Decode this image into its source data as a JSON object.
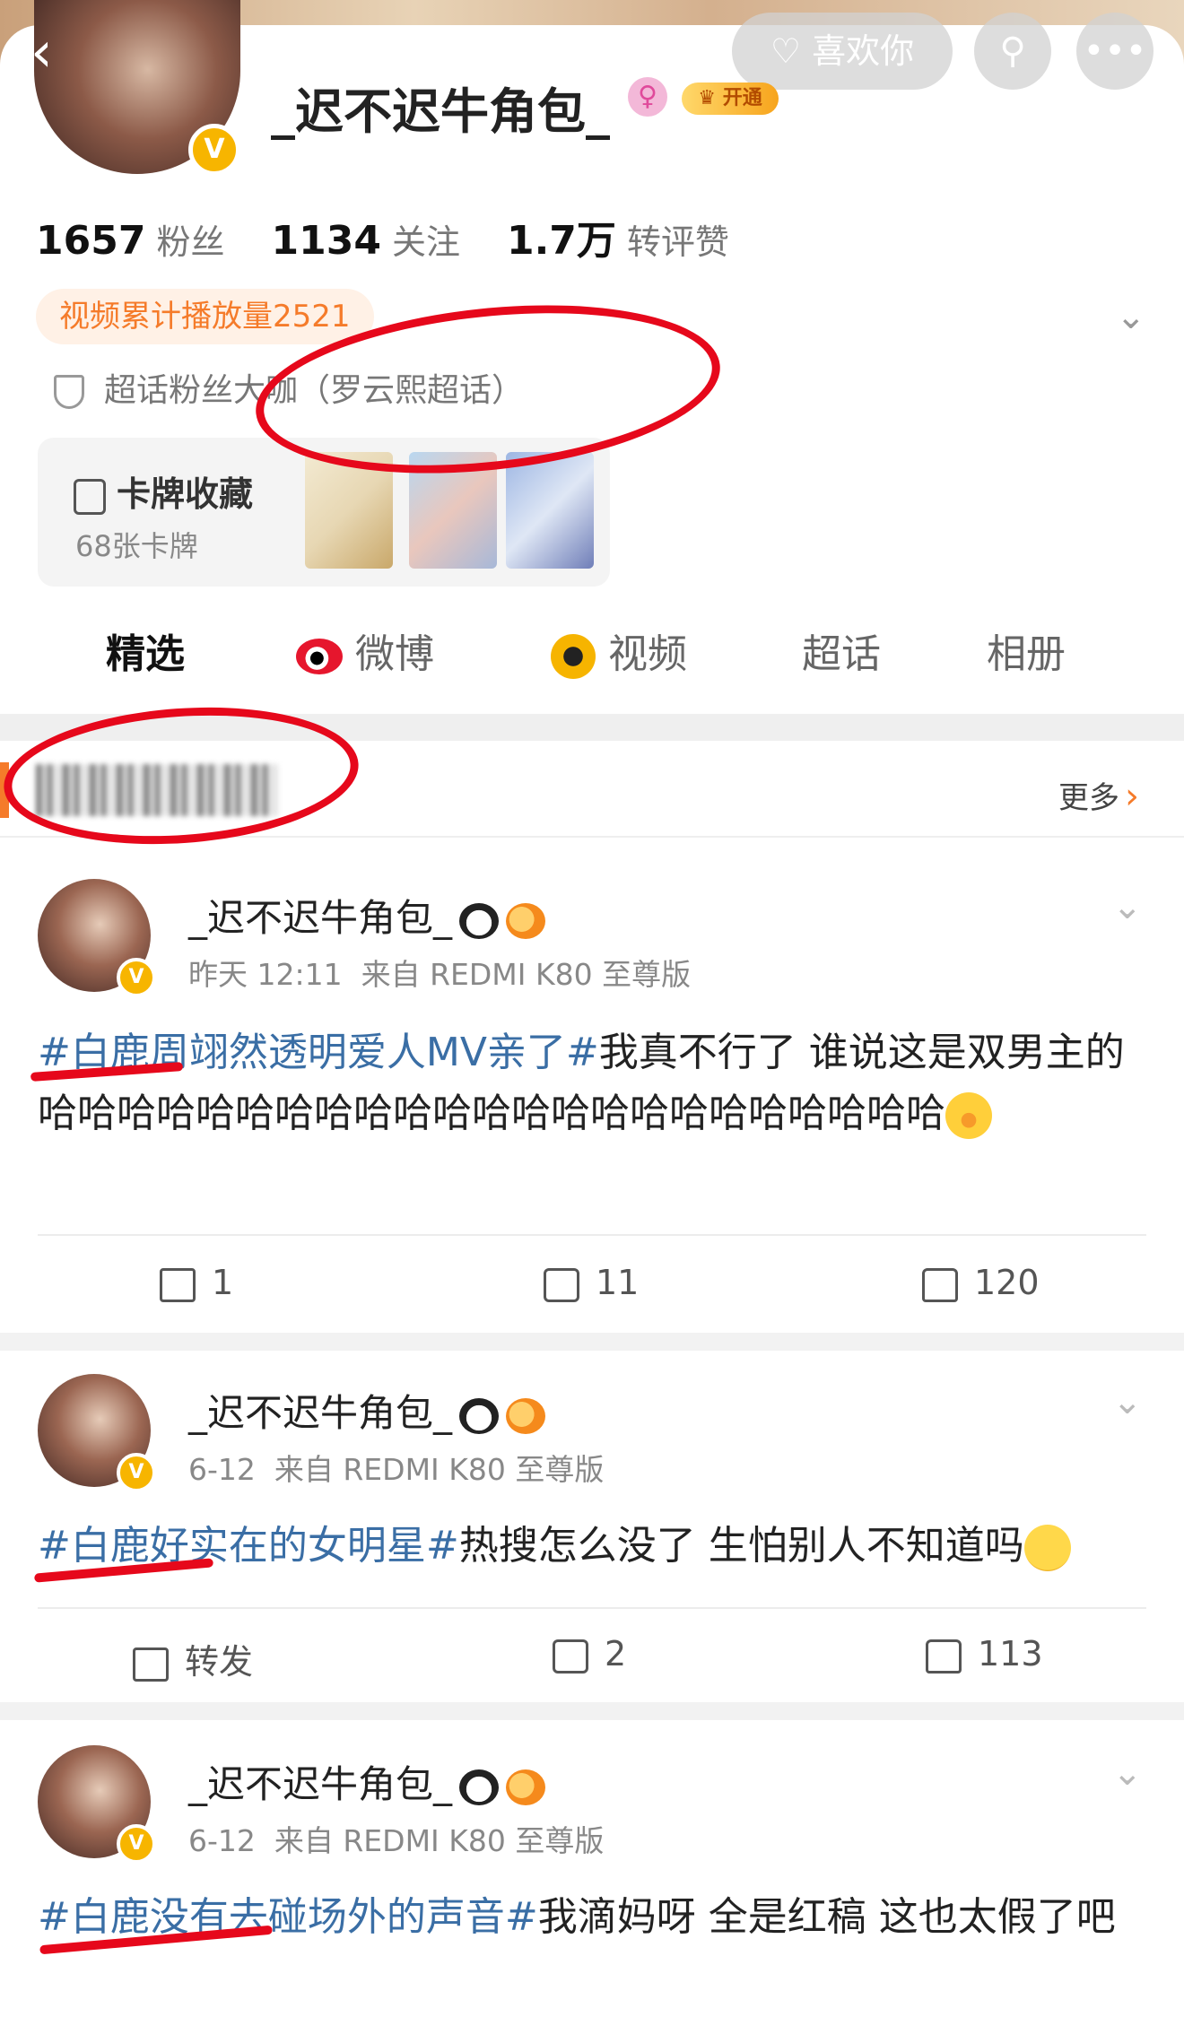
{
  "header": {
    "username": "_迟不迟牛角包_",
    "verified_mark": "V",
    "vip_label": "开通",
    "like_button": "喜欢你",
    "search_icon": "search-icon",
    "more_icon": "more-icon"
  },
  "stats": [
    {
      "num": "1657",
      "label": "粉丝"
    },
    {
      "num": "1134",
      "label": "关注"
    },
    {
      "num": "1.7万",
      "label": "转评赞"
    }
  ],
  "play_count": "视频累计播放量2521",
  "supertalk": "超话粉丝大咖（罗云熙超话）",
  "cards": {
    "title": "卡牌收藏",
    "count": "68张卡牌"
  },
  "tabs": [
    "精选",
    "微博",
    "视频",
    "超话",
    "相册"
  ],
  "section": {
    "more": "更多"
  },
  "posts": [
    {
      "name": "_迟不迟牛角包_",
      "time": "昨天 12:11",
      "source": "来自 REDMI K80 至尊版",
      "hashtag": "#白鹿周翊然透明爱人MV亲了#",
      "text": "我真不行了 谁说这是双男主的哈哈哈哈哈哈哈哈哈哈哈哈哈哈哈哈哈哈哈哈哈哈哈",
      "repost": "1",
      "comments": "11",
      "likes": "120"
    },
    {
      "name": "_迟不迟牛角包_",
      "time": "6-12",
      "source": "来自 REDMI K80 至尊版",
      "hashtag": "#白鹿好实在的女明星#",
      "text": "热搜怎么没了 生怕别人不知道吗",
      "repost": "转发",
      "comments": "2",
      "likes": "113"
    },
    {
      "name": "_迟不迟牛角包_",
      "time": "6-12",
      "source": "来自 REDMI K80 至尊版",
      "hashtag": "#白鹿没有去碰场外的声音#",
      "text": "我滴妈呀 全是红稿 这也太假了吧"
    }
  ]
}
